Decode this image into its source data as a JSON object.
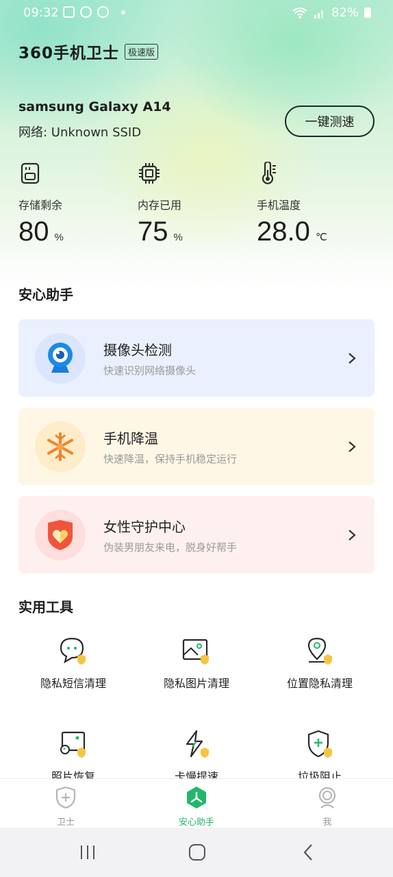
{
  "status_bar": {
    "time": "09:32",
    "battery": "82%"
  },
  "header": {
    "logo": "360手机卫士",
    "badge": "极速版",
    "device": "samsung Galaxy A14",
    "network": "网络: Unknown SSID",
    "speed_button": "一键测速"
  },
  "stats": [
    {
      "icon": "sd-card-icon",
      "label": "存储剩余",
      "value": "80",
      "unit": "%"
    },
    {
      "icon": "chip-icon",
      "label": "内存已用",
      "value": "75",
      "unit": "%"
    },
    {
      "icon": "thermometer-icon",
      "label": "手机温度",
      "value": "28.0",
      "unit": "℃"
    }
  ],
  "assistant": {
    "title": "安心助手",
    "cards": [
      {
        "title": "摄像头检测",
        "subtitle": "快速识别网络摄像头",
        "icon": "webcam-icon",
        "bg": "#eaf0fe"
      },
      {
        "title": "手机降温",
        "subtitle": "快速降温，保持手机稳定运行",
        "icon": "snowflake-icon",
        "bg": "#fff7e6"
      },
      {
        "title": "女性守护中心",
        "subtitle": "伪装男朋友来电，脱身好帮手",
        "icon": "heart-shield-icon",
        "bg": "#fff0f0"
      }
    ]
  },
  "tools": {
    "title": "实用工具",
    "items": [
      {
        "label": "隐私短信清理",
        "icon": "chat-bubble-icon"
      },
      {
        "label": "隐私图片清理",
        "icon": "image-icon"
      },
      {
        "label": "位置隐私清理",
        "icon": "location-pin-icon"
      },
      {
        "label": "照片恢复",
        "icon": "photo-restore-icon"
      },
      {
        "label": "卡慢提速",
        "icon": "lightning-icon"
      },
      {
        "label": "垃圾阻止",
        "icon": "shield-plus-icon"
      }
    ]
  },
  "bottom_nav": [
    {
      "label": "卫士",
      "icon": "shield-plus-icon",
      "active": false
    },
    {
      "label": "安心助手",
      "icon": "assistant-hex-icon",
      "active": true
    },
    {
      "label": "我",
      "icon": "profile-icon",
      "active": false
    }
  ],
  "colors": {
    "accent": "#22b86a",
    "text": "#222222",
    "subtext": "#9a9a9a"
  }
}
